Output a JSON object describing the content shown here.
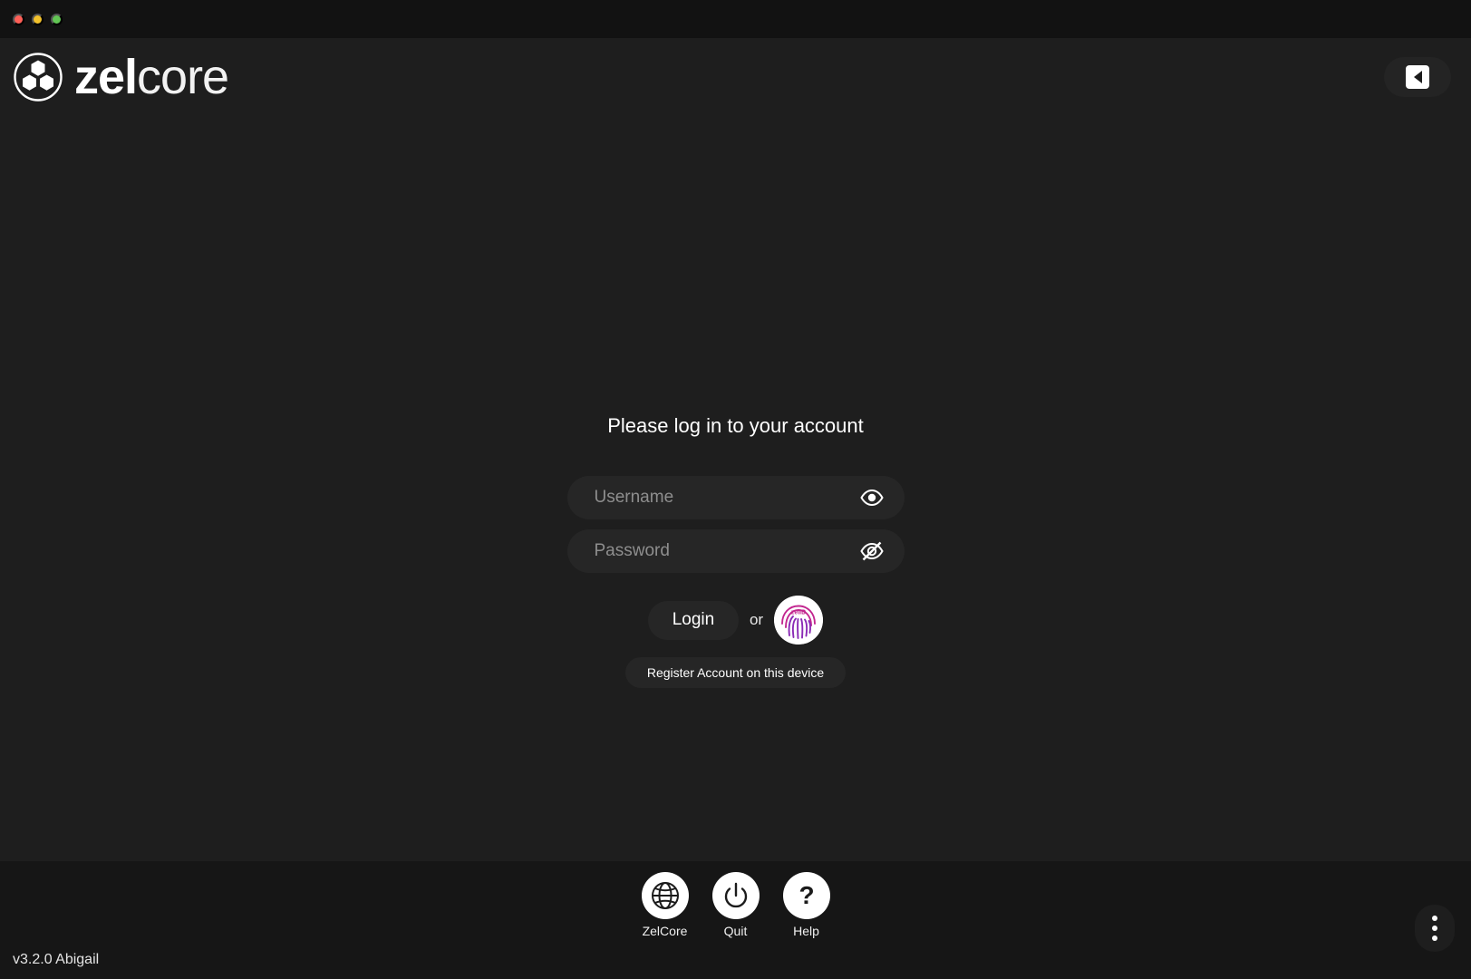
{
  "window": {
    "controls": [
      {
        "name": "close",
        "color": "#ff5f57"
      },
      {
        "name": "minimize",
        "color": "#f2c12b"
      },
      {
        "name": "maximize",
        "color": "#62c554"
      }
    ]
  },
  "header": {
    "brand_bold": "zel",
    "brand_light": "core",
    "logo_icon": "zelcore-cubes-icon",
    "collapse_icon": "collapse-left-icon"
  },
  "login": {
    "title": "Please log in to your account",
    "username": {
      "placeholder": "Username",
      "value": "",
      "toggle_icon": "eye-icon"
    },
    "password": {
      "placeholder": "Password",
      "value": "",
      "toggle_icon": "eye-off-icon"
    },
    "login_label": "Login",
    "or_label": "or",
    "zelid_icon": "fingerprint-zelid-icon",
    "zelid_text": "zelID",
    "register_label": "Register Account on this device"
  },
  "bottom": {
    "items": [
      {
        "label": "ZelCore",
        "icon": "globe-icon"
      },
      {
        "label": "Quit",
        "icon": "power-icon"
      },
      {
        "label": "Help",
        "icon": "question-mark-icon"
      }
    ],
    "version": "v3.2.0 Abigail",
    "menu_icon": "kebab-menu-icon"
  },
  "colors": {
    "background": "#1e1e1e",
    "titlebar": "#121212",
    "bottombar": "#161616",
    "field": "#262626",
    "accent_magenta": "#c2268f"
  }
}
